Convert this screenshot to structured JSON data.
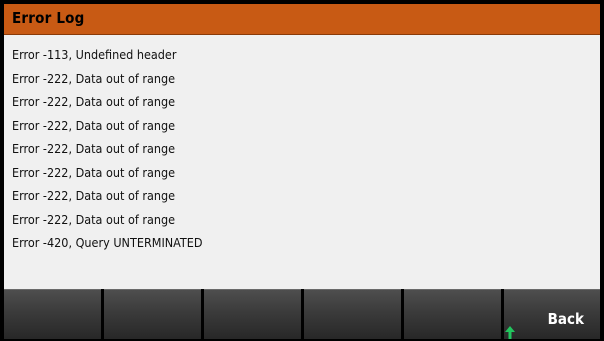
{
  "header": {
    "title": "Error Log"
  },
  "errors": [
    "Error -113, Undefined header",
    "Error -222, Data out of range",
    "Error -222, Data out of range",
    "Error -222, Data out of range",
    "Error -222, Data out of range",
    "Error -222, Data out of range",
    "Error -222, Data out of range",
    "Error -222, Data out of range",
    "Error -420, Query UNTERMINATED"
  ],
  "softkeys": [
    {
      "label": ""
    },
    {
      "label": ""
    },
    {
      "label": ""
    },
    {
      "label": ""
    },
    {
      "label": ""
    },
    {
      "label": "Back"
    }
  ],
  "colors": {
    "title_bar": "#c85a14",
    "background": "#f0f0f0",
    "softkey": "#3a3a3a",
    "cursor_arrow": "#22c55e"
  },
  "icons": {
    "cursor": "up-arrow-icon"
  }
}
